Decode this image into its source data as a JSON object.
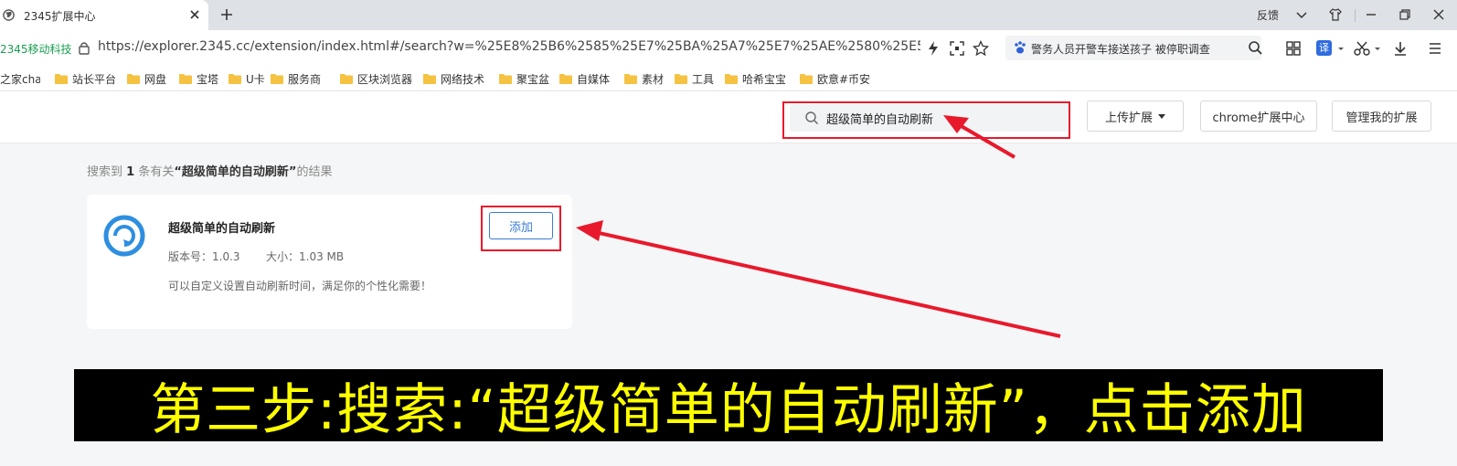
{
  "tab": {
    "title": "2345扩展中心"
  },
  "window": {
    "feedback": "反馈"
  },
  "address": {
    "site_name": "2345移动科技",
    "url": "https://explorer.2345.cc/extension/index.html#/search?w=%25E8%25B6%2585%25E7%25BA%25A7%25E7%25AE%2580%25E5%258..."
  },
  "search_box": {
    "news": "警务人员开警车接送孩子 被停职调查"
  },
  "bookmarks": {
    "first": "之家cha",
    "items": [
      "站长平台",
      "网盘",
      "宝塔",
      "U卡",
      "服务商",
      "区块浏览器",
      "网络技术",
      "聚宝盆",
      "自媒体",
      "素材",
      "工具",
      "哈希宝宝",
      "欧意#币安"
    ]
  },
  "header": {
    "search_value": "超级简单的自动刷新",
    "upload_label": "上传扩展",
    "chrome_center_label": "chrome扩展中心",
    "manage_label": "管理我的扩展"
  },
  "results": {
    "prefix": "搜索到",
    "count": "1",
    "middle": "条有关",
    "keyword": "“超级简单的自动刷新”",
    "suffix": "的结果"
  },
  "extension": {
    "name": "超级简单的自动刷新",
    "version": "版本号：1.0.3",
    "size": "大小：1.03 MB",
    "description": "可以自定义设置自动刷新时间，满足你的个性化需要！",
    "add_label": "添加"
  },
  "caption": {
    "text": "第三步:搜索:“超级简单的自动刷新”，点击添加"
  },
  "colors": {
    "accent": "#3a7bd5",
    "annotation_red": "#e8192c",
    "caption_yellow": "#ffff00"
  }
}
